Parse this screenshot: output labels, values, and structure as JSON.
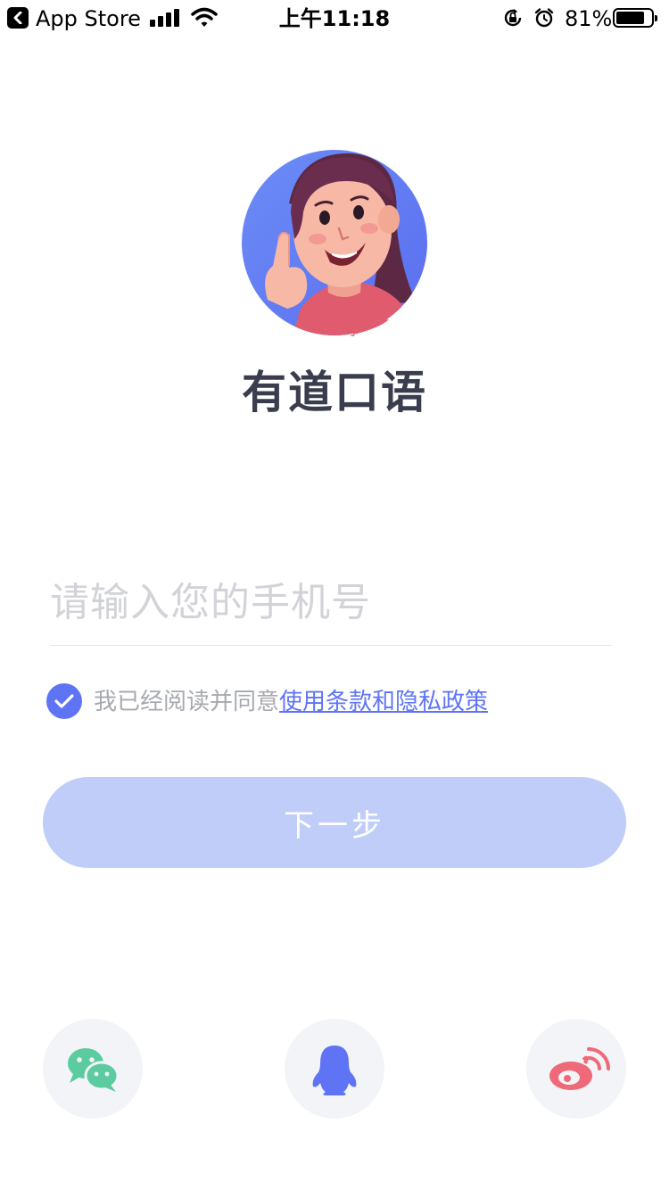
{
  "status_bar": {
    "back_app": "App Store",
    "time": "上午11:18",
    "battery_percent": "81%",
    "battery_level": 0.81
  },
  "app": {
    "title": "有道口语"
  },
  "login": {
    "phone_placeholder": "请输入您的手机号",
    "phone_value": "",
    "agree_checked": true,
    "agree_prefix": "我已经阅读并同意",
    "agree_link": "使用条款和隐私政策",
    "next_label": "下一步"
  },
  "social_login": [
    {
      "name": "wechat",
      "icon": "wechat-icon",
      "color": "#5ccba0"
    },
    {
      "name": "qq",
      "icon": "qq-icon",
      "color": "#5f74f5"
    },
    {
      "name": "weibo",
      "icon": "weibo-icon",
      "color": "#ee6a78"
    }
  ],
  "colors": {
    "accent": "#5f74f5",
    "button_disabled": "#c0cdf9",
    "title": "#3a3d4d",
    "hint": "#a7a9b1"
  }
}
